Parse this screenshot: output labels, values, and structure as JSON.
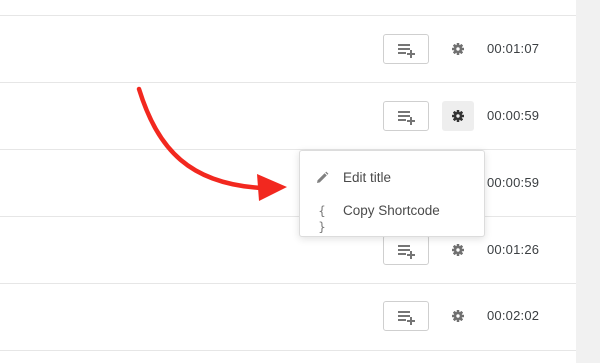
{
  "rows": [
    {
      "duration": "00:01:07"
    },
    {
      "duration": "00:00:59"
    },
    {
      "duration": "00:00:59"
    },
    {
      "duration": "00:01:26"
    },
    {
      "duration": "00:02:02"
    }
  ],
  "menu": {
    "items": [
      {
        "label": "Edit title",
        "icon": "pencil-icon"
      },
      {
        "label": "Copy Shortcode",
        "icon": "braces-icon",
        "glyph": "{ }"
      }
    ]
  },
  "colors": {
    "annotation_arrow": "#f2281f",
    "divider": "#e6e6e6",
    "icon_gray": "#777777",
    "active_gear_bg": "#eeeeee",
    "scrollbar_track": "#f1f1f1"
  }
}
